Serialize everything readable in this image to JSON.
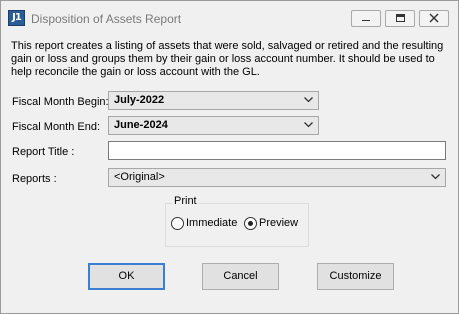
{
  "window": {
    "title": "Disposition of Assets Report",
    "icon_label": "J1",
    "controls": [
      "minimize-icon",
      "maximize-icon",
      "close-icon"
    ]
  },
  "description": "This report creates a listing of assets that were sold, salvaged or retired and the resulting gain or loss and groups them by their gain or loss account number.  It should be used to help reconcile the gain or loss account with the GL.",
  "form": {
    "fiscal_month_begin": {
      "label": "Fiscal Month Begin:",
      "value": "July-2022"
    },
    "fiscal_month_end": {
      "label": "Fiscal Month End:",
      "value": "June-2024"
    },
    "report_title": {
      "label": "Report Title :",
      "value": ""
    },
    "reports": {
      "label": "Reports :",
      "value": "<Original>"
    }
  },
  "print": {
    "label": "Print",
    "options": [
      {
        "label": "Immediate",
        "selected": false
      },
      {
        "label": "Preview",
        "selected": true
      }
    ]
  },
  "buttons": {
    "ok": "OK",
    "cancel": "Cancel",
    "customize": "Customize"
  }
}
